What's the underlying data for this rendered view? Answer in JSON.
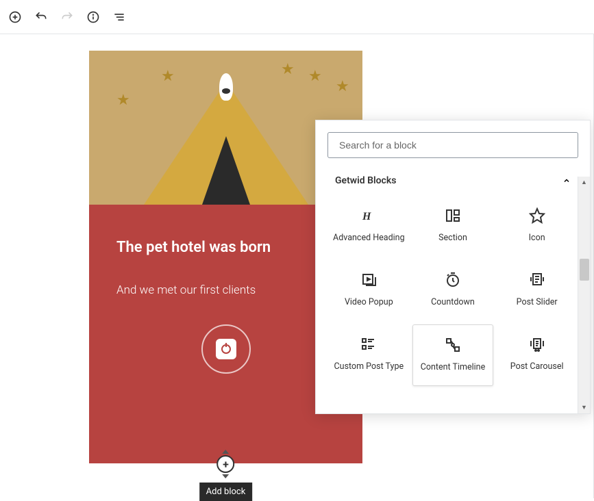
{
  "toolbar": {
    "add": "add",
    "undo": "undo",
    "redo": "redo",
    "info": "info",
    "outline": "outline"
  },
  "content": {
    "title": "The pet hotel was born",
    "subtitle": "And we met our first clients"
  },
  "addBlock": {
    "tooltip": "Add block"
  },
  "inserter": {
    "searchPlaceholder": "Search for a block",
    "categoryTitle": "Getwid Blocks",
    "blocks": [
      {
        "label": "Advanced Heading"
      },
      {
        "label": "Section"
      },
      {
        "label": "Icon"
      },
      {
        "label": "Video Popup"
      },
      {
        "label": "Countdown"
      },
      {
        "label": "Post Slider"
      },
      {
        "label": "Custom Post Type"
      },
      {
        "label": "Content Timeline"
      },
      {
        "label": "Post Carousel"
      }
    ]
  }
}
